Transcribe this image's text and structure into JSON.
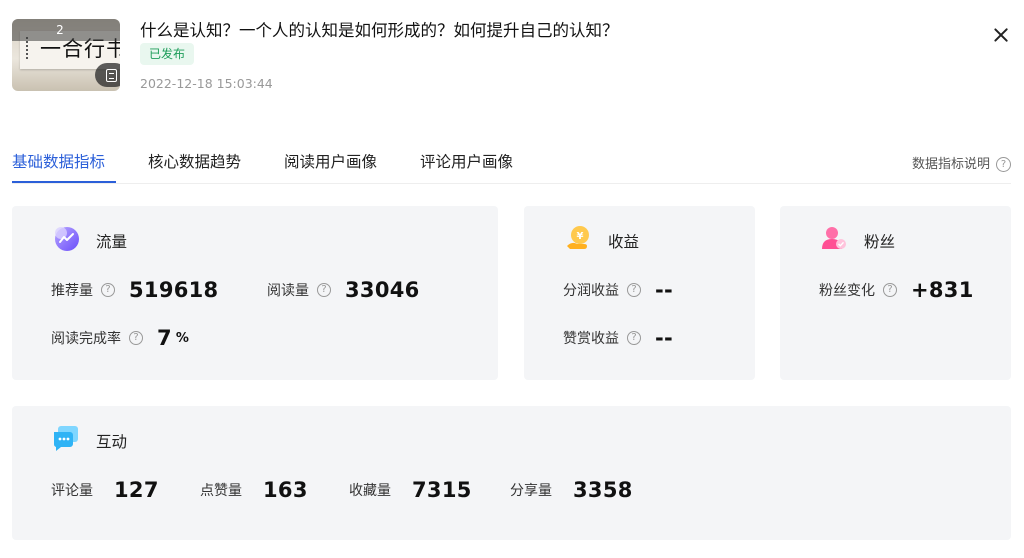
{
  "article": {
    "thumbnail": {
      "image_count": "2",
      "calligraphy": "一合行书",
      "icon": "document-icon"
    },
    "title": "什么是认知？一个人的认知是如何形成的？如何提升自己的认知？",
    "status": "已发布",
    "published_at": "2022-12-18 15:03:44"
  },
  "close_icon": "close-icon",
  "tabs": [
    {
      "label": "基础数据指标",
      "active": true
    },
    {
      "label": "核心数据趋势",
      "active": false
    },
    {
      "label": "阅读用户画像",
      "active": false
    },
    {
      "label": "评论用户画像",
      "active": false
    }
  ],
  "help_link": {
    "label": "数据指标说明",
    "icon": "question-icon"
  },
  "cards": {
    "traffic": {
      "title": "流量",
      "icon": "traffic-chart-icon",
      "metrics": [
        {
          "label": "推荐量",
          "value": "519618"
        },
        {
          "label": "阅读量",
          "value": "33046"
        },
        {
          "label": "阅读完成率",
          "value": "7",
          "unit": "%"
        }
      ]
    },
    "revenue": {
      "title": "收益",
      "icon": "yuan-hand-icon",
      "metrics": [
        {
          "label": "分润收益",
          "value": "--"
        },
        {
          "label": "赞赏收益",
          "value": "--"
        }
      ]
    },
    "fans": {
      "title": "粉丝",
      "icon": "fans-user-icon",
      "metrics": [
        {
          "label": "粉丝变化",
          "value": "+831"
        }
      ]
    },
    "interaction": {
      "title": "互动",
      "icon": "chat-bubble-icon",
      "metrics": [
        {
          "label": "评论量",
          "value": "127"
        },
        {
          "label": "点赞量",
          "value": "163"
        },
        {
          "label": "收藏量",
          "value": "7315"
        },
        {
          "label": "分享量",
          "value": "3358"
        }
      ]
    }
  },
  "colors": {
    "accent": "#2b5fd9",
    "published_green": "#1e9d5a",
    "card_bg": "#f4f5f7"
  }
}
